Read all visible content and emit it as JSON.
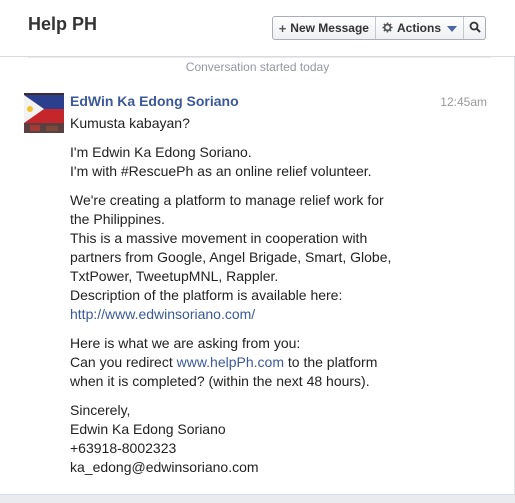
{
  "header": {
    "title": "Help PH",
    "new_message_label": "New Message",
    "new_message_icon": "plus-icon",
    "actions_label": "Actions",
    "actions_icon": "gear-icon",
    "search_icon": "search-icon"
  },
  "conversation": {
    "started_label": "Conversation started today"
  },
  "message": {
    "sender": "EdWin Ka Edong Soriano",
    "time": "12:45am",
    "avatar_icon": "philippine-flag-avatar",
    "paragraphs": [
      {
        "lines": [
          "Kumusta kabayan?"
        ]
      },
      {
        "lines": [
          "I'm Edwin Ka Edong Soriano.",
          "I'm with #RescuePh as an online relief volunteer."
        ]
      },
      {
        "lines": [
          "We're creating a platform to manage relief work for",
          "the Philippines.",
          "This is a massive movement in cooperation with",
          "partners from Google, Angel Brigade, Smart, Globe,",
          "TxtPower, TweetupMNL, Rappler.",
          "Description of the platform is available here:"
        ],
        "link": "http://www.edwinsoriano.com/"
      },
      {
        "line1": "Here is what we are asking from you:",
        "line2_before": "Can you redirect ",
        "line2_link": "www.helpPh.com",
        "line2_after": " to the platform",
        "line3": "when it is completed? (within the next 48 hours)."
      },
      {
        "lines": [
          "Sincerely,",
          "Edwin Ka Edong Soriano",
          "+63918-8002323",
          "ka_edong@edwinsoriano.com"
        ]
      }
    ]
  },
  "colors": {
    "link": "#3b5998",
    "text": "#222222",
    "muted": "#999999"
  }
}
